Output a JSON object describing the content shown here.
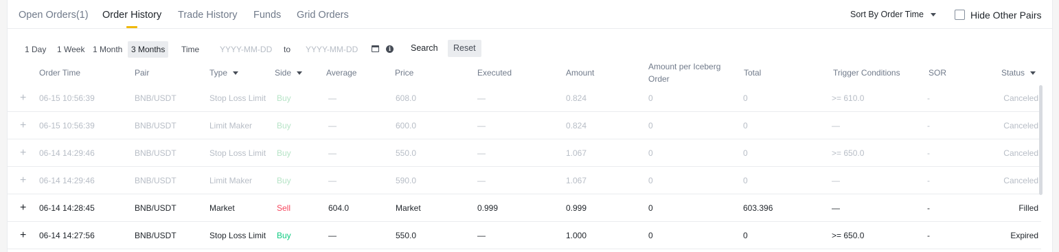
{
  "tabs": [
    "Open Orders(1)",
    "Order History",
    "Trade History",
    "Funds",
    "Grid Orders"
  ],
  "sort_label": "Sort By Order Time",
  "hide_other_pairs": "Hide Other Pairs",
  "filters": {
    "ranges": [
      "1 Day",
      "1 Week",
      "1 Month",
      "3 Months"
    ],
    "active_range": "3 Months",
    "time_label": "Time",
    "start_placeholder": "YYYY-MM-DD",
    "to_label": "to",
    "end_placeholder": "YYYY-MM-DD",
    "search": "Search",
    "reset": "Reset"
  },
  "columns": {
    "order_time": "Order Time",
    "pair": "Pair",
    "type": "Type",
    "side": "Side",
    "average": "Average",
    "price": "Price",
    "executed": "Executed",
    "amount": "Amount",
    "iceberg_1": "Amount per Iceberg",
    "iceberg_2": "Order",
    "total": "Total",
    "trigger": "Trigger Conditions",
    "sor": "SOR",
    "status": "Status"
  },
  "rows": [
    {
      "expand": "+",
      "time": "06-15 10:56:39",
      "pair": "BNB/USDT",
      "type": "Stop Loss Limit",
      "side": "Buy",
      "average": "—",
      "price": "608.0",
      "executed": "—",
      "amount": "0.824",
      "iceberg": "0",
      "total": "0",
      "trigger": ">= 610.0",
      "sor": "-",
      "status": "Canceled"
    },
    {
      "expand": "+",
      "time": "06-15 10:56:39",
      "pair": "BNB/USDT",
      "type": "Limit Maker",
      "side": "Buy",
      "average": "—",
      "price": "600.0",
      "executed": "—",
      "amount": "0.824",
      "iceberg": "0",
      "total": "0",
      "trigger": "—",
      "sor": "-",
      "status": "Canceled"
    },
    {
      "expand": "+",
      "time": "06-14 14:29:46",
      "pair": "BNB/USDT",
      "type": "Stop Loss Limit",
      "side": "Buy",
      "average": "—",
      "price": "550.0",
      "executed": "—",
      "amount": "1.067",
      "iceberg": "0",
      "total": "0",
      "trigger": ">= 650.0",
      "sor": "-",
      "status": "Canceled"
    },
    {
      "expand": "+",
      "time": "06-14 14:29:46",
      "pair": "BNB/USDT",
      "type": "Limit Maker",
      "side": "Buy",
      "average": "—",
      "price": "590.0",
      "executed": "—",
      "amount": "1.067",
      "iceberg": "0",
      "total": "0",
      "trigger": "—",
      "sor": "-",
      "status": "Canceled"
    },
    {
      "expand": "+",
      "time": "06-14 14:28:45",
      "pair": "BNB/USDT",
      "type": "Market",
      "side": "Sell",
      "average": "604.0",
      "price": "Market",
      "executed": "0.999",
      "amount": "0.999",
      "iceberg": "0",
      "total": "603.396",
      "trigger": "—",
      "sor": "-",
      "status": "Filled"
    },
    {
      "expand": "+",
      "time": "06-14 14:27:56",
      "pair": "BNB/USDT",
      "type": "Stop Loss Limit",
      "side": "Buy",
      "average": "—",
      "price": "550.0",
      "executed": "—",
      "amount": "1.000",
      "iceberg": "0",
      "total": "0",
      "trigger": ">= 650.0",
      "sor": "-",
      "status": "Expired"
    }
  ]
}
